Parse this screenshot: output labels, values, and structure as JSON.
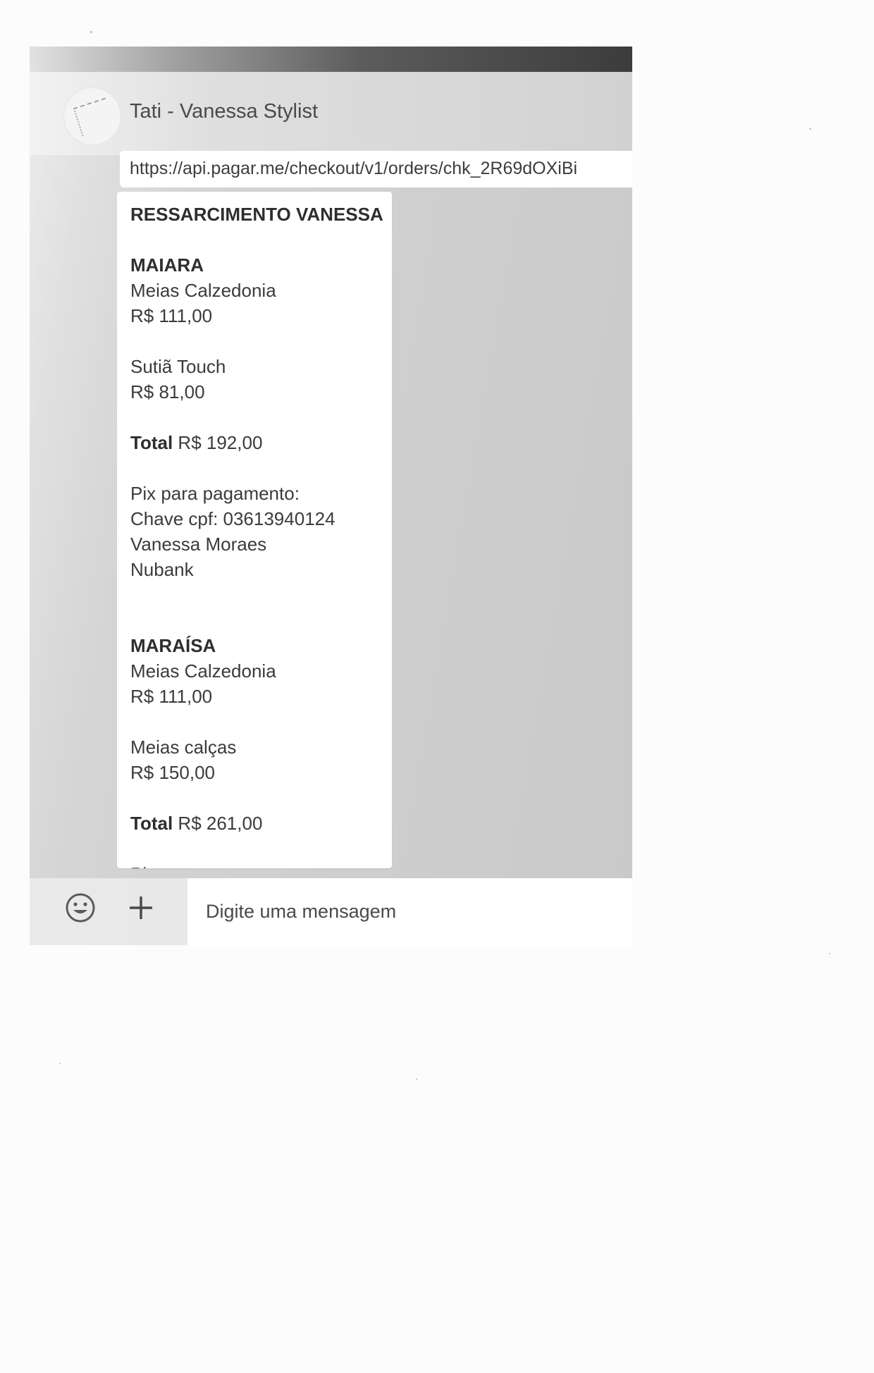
{
  "chat": {
    "contact_name": "Tati - Vanessa Stylist",
    "link_preview": "https://api.pagar.me/checkout/v1/orders/chk_2R69dOXiBi",
    "message": {
      "title": "RESSARCIMENTO VANESSA",
      "person1": {
        "name": "MAIARA",
        "item1_name": "Meias Calzedonia",
        "item1_price": "R$ 111,00",
        "item2_name": "Sutiã Touch",
        "item2_price": "R$ 81,00",
        "total_label": "Total",
        "total_value": "R$ 192,00"
      },
      "pix": {
        "heading": "Pix para pagamento:",
        "key": "Chave cpf: 03613940124",
        "holder": "Vanessa Moraes",
        "bank": "Nubank"
      },
      "person2": {
        "name": "MARAÍSA",
        "item1_name": "Meias Calzedonia",
        "item1_price": "R$ 111,00",
        "item2_name": "Meias calças",
        "item2_price": "R$ 150,00",
        "total_label": "Total",
        "total_value": "R$ 261,00"
      },
      "cut_off_line": "Pix para pagamento:"
    }
  },
  "composer": {
    "placeholder": "Digite uma mensagem",
    "emoji_icon": "smiley-icon",
    "attach_icon": "plus-icon"
  }
}
